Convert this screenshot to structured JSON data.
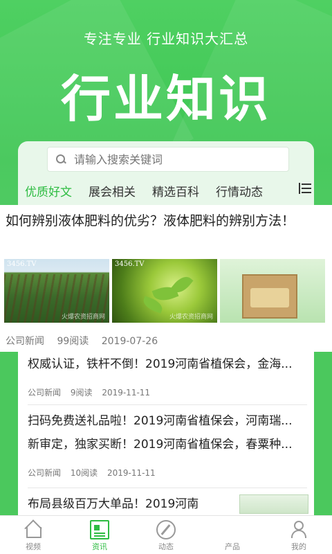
{
  "hero": {
    "subtitle": "专注专业 行业知识大汇总",
    "title": "行业知识"
  },
  "search": {
    "placeholder": "请输入搜索关键词",
    "icon": "search-icon"
  },
  "tabs": [
    {
      "label": "优质好文",
      "active": true
    },
    {
      "label": "展会相关",
      "active": false
    },
    {
      "label": "精选百科",
      "active": false
    },
    {
      "label": "行情动态",
      "active": false
    }
  ],
  "featured": {
    "title": "如何辨别液体肥料的优劣？液体肥料的辨别方法！",
    "thumbs": [
      {
        "tag": "3456.TV",
        "caption": "火爆农资招商网",
        "icon": "field-photo"
      },
      {
        "tag": "3456.TV",
        "caption": "火爆农资招商网",
        "icon": "sprout-photo"
      },
      {
        "tag": "",
        "caption": "",
        "icon": "product-box-photo"
      }
    ],
    "category": "公司新闻",
    "reads": "99阅读",
    "date": "2019-07-26"
  },
  "news": [
    {
      "title": "权威认证，铁杆不倒！2019河南省植保会，金海...",
      "category": "公司新闻",
      "reads": "9阅读",
      "date": "2019-11-11"
    },
    {
      "title": "扫码免费送礼品啦！2019河南省植保会，河南瑞...",
      "category": "",
      "reads": "",
      "date": ""
    },
    {
      "title": "新审定，独家买断！2019河南省植保会，春粟种...",
      "category": "公司新闻",
      "reads": "10阅读",
      "date": "2019-11-11"
    },
    {
      "title": "布局县级百万大单品！2019河南",
      "category": "",
      "reads": "",
      "date": ""
    }
  ],
  "tabbar": [
    {
      "label": "视频",
      "icon": "home-icon",
      "active": false
    },
    {
      "label": "资讯",
      "icon": "news-icon",
      "active": true
    },
    {
      "label": "动态",
      "icon": "compass-icon",
      "active": false
    },
    {
      "label": "产品",
      "icon": "grid-icon",
      "active": false
    },
    {
      "label": "我的",
      "icon": "user-icon",
      "active": false
    }
  ],
  "colors": {
    "brand": "#3cc552",
    "accent": "#2ebc42",
    "text": "#222222",
    "muted": "#777777"
  }
}
